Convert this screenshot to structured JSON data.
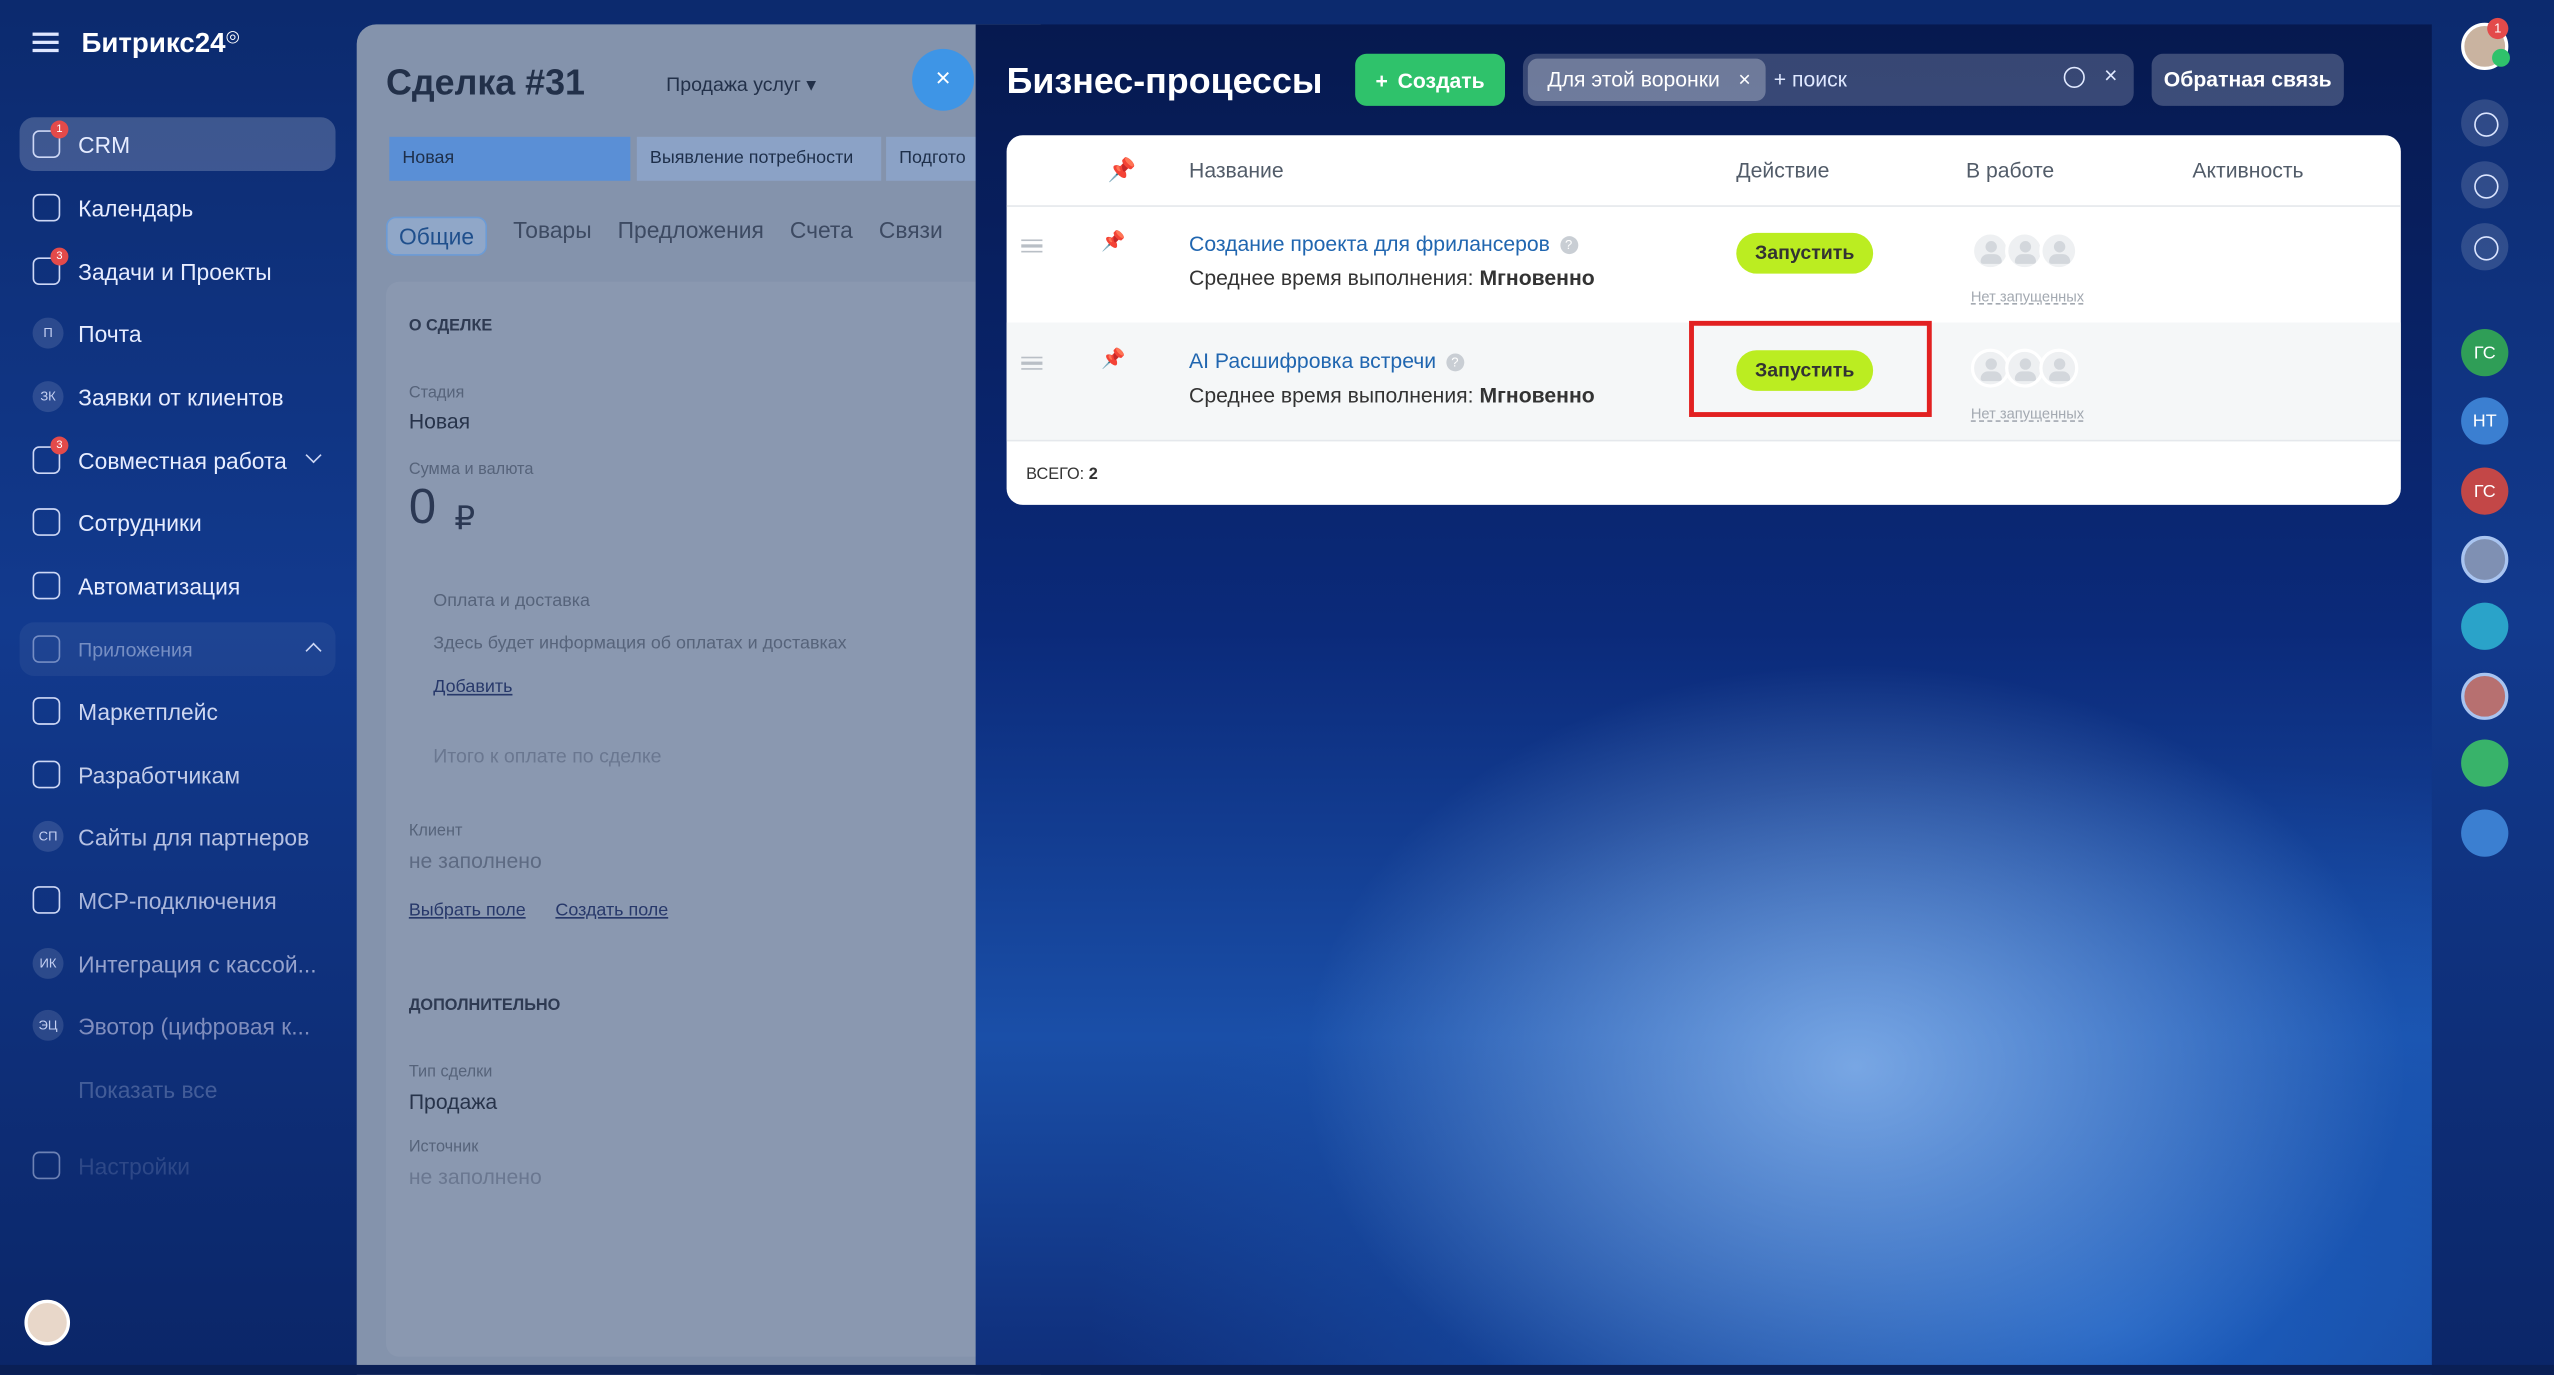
{
  "app": {
    "logo_text": "Битрикс24",
    "logo_mark": "◎"
  },
  "left_menu": {
    "items": [
      {
        "label": "CRM",
        "counter": "1"
      },
      {
        "label": "Календарь"
      },
      {
        "label": "Задачи и Проекты",
        "counter": "3"
      },
      {
        "label": "Почта",
        "avatar": "П"
      },
      {
        "label": "Заявки от клиентов",
        "avatar": "ЗК"
      },
      {
        "label": "Совместная работа",
        "counter": "3"
      },
      {
        "label": "Сотрудники"
      },
      {
        "label": "Автоматизация"
      },
      {
        "label": "Приложения"
      },
      {
        "label": "Маркетплейс"
      },
      {
        "label": "Разработчикам"
      },
      {
        "label": "Сайты для партнеров",
        "avatar": "СП"
      },
      {
        "label": "MCP-подключения"
      },
      {
        "label": "Интеграция с кассой...",
        "avatar": "ИК"
      },
      {
        "label": "Эвотор (цифровая к...",
        "avatar": "ЭЦ"
      },
      {
        "label": "Показать все"
      },
      {
        "label": "Настройки"
      }
    ]
  },
  "deal": {
    "title": "Сделка #31",
    "pipeline": "Продажа услуг",
    "close": "×",
    "stages": [
      "Новая",
      "Выявление потребности",
      "Подгото"
    ],
    "tabs": [
      "Общие",
      "Товары",
      "Предложения",
      "Счета",
      "Связи"
    ],
    "section_about": "О СДЕЛКЕ",
    "stage_label": "Стадия",
    "stage_value": "Новая",
    "amount_label": "Сумма и валюта",
    "amount_value": "0",
    "currency": "₽",
    "payment_label": "Оплата и доставка",
    "payment_hint": "Здесь будет информация об оплатах и доставках",
    "add_link": "Добавить",
    "total_pay": "Итого к оплате по сделке",
    "client_label": "Клиент",
    "client_value": "не заполнено",
    "choose_field": "Выбрать поле",
    "create_field": "Создать поле",
    "section_extra": "ДОПОЛНИТЕЛЬНО",
    "type_label": "Тип сделки",
    "type_value": "Продажа",
    "source_label": "Источник",
    "source_value": "не заполнено"
  },
  "bp": {
    "title": "Бизнес-процессы",
    "create_label": "Создать",
    "filter_chip": "Для этой воронки",
    "search_placeholder": "+ поиск",
    "feedback_label": "Обратная связь",
    "columns": {
      "name": "Название",
      "action": "Действие",
      "in_work": "В работе",
      "activity": "Активность"
    },
    "rows": [
      {
        "name": "Создание проекта для фрилансеров",
        "avg_prefix": "Среднее время выполнения:",
        "avg_value": "Мгновенно",
        "action": "Запустить",
        "none_running": "Нет запущенных"
      },
      {
        "name": "AI Расшифровка встречи",
        "avg_prefix": "Среднее время выполнения:",
        "avg_value": "Мгновенно",
        "action": "Запустить",
        "none_running": "Нет запущенных"
      }
    ],
    "total_label": "ВСЕГО:",
    "total_value": "2"
  },
  "right_bar": {
    "notif_count": "1",
    "avatars": [
      "ГС",
      "НТ",
      "ГС"
    ]
  },
  "colors": {
    "run_button": "#bbed21",
    "create_button": "#2fc26b",
    "highlight": "#e22121",
    "link": "#2066b0"
  }
}
